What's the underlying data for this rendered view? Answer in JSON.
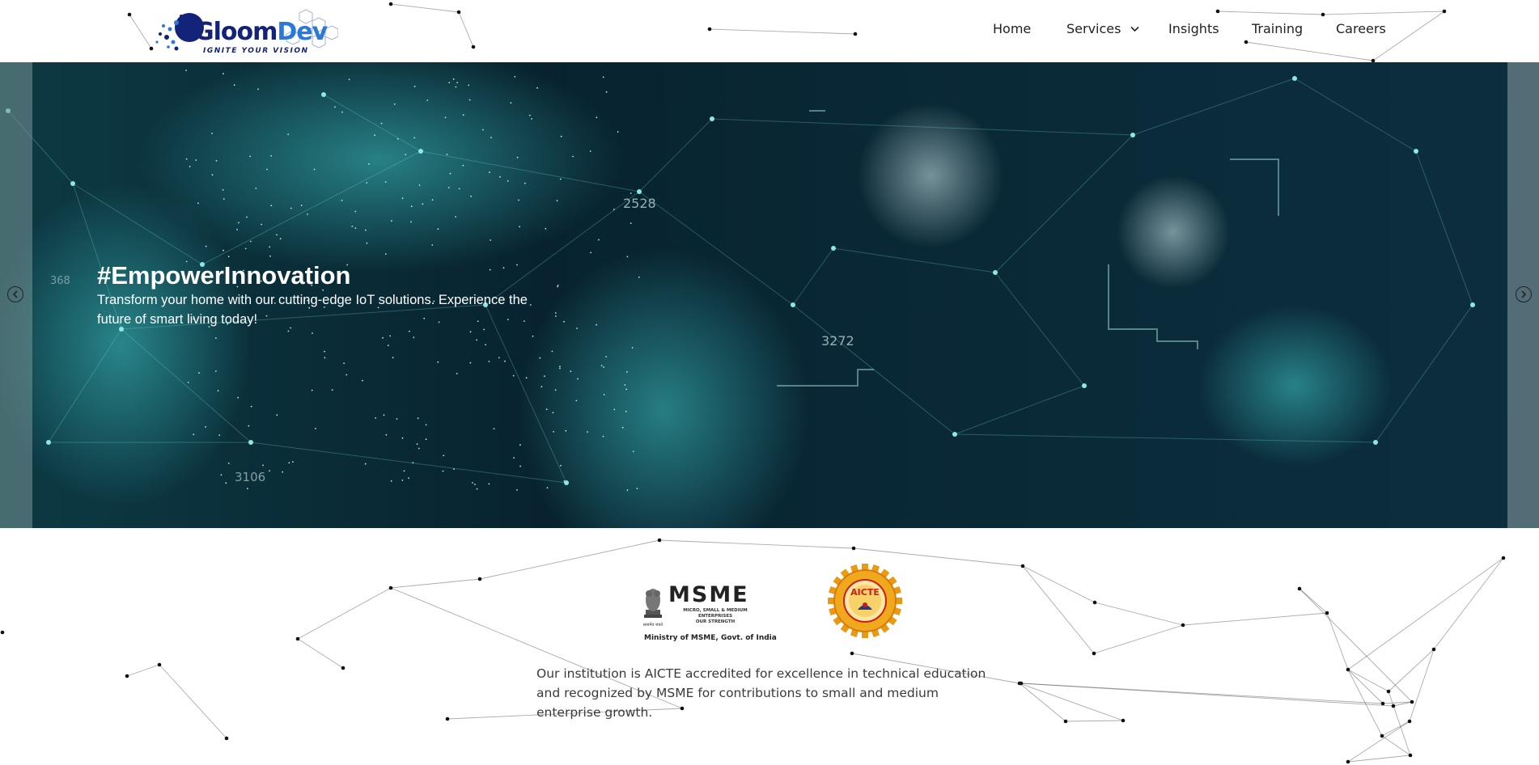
{
  "header": {
    "logo": {
      "name_primary": "Gloom",
      "name_accent": "Dev",
      "tagline": "IGNITE YOUR VISION"
    },
    "nav": [
      {
        "label": "Home"
      },
      {
        "label": "Services",
        "has_dropdown": true
      },
      {
        "label": "Insights"
      },
      {
        "label": "Training"
      },
      {
        "label": "Careers"
      }
    ]
  },
  "hero": {
    "title": "#EmpowerInnovation",
    "subtitle": "Transform your home with our cutting-edge IoT solutions. Experience the future of smart living today!",
    "background_numbers": [
      "2528",
      "3272",
      "3106",
      "368"
    ],
    "prev_icon": "chevron-left-circle-icon",
    "next_icon": "chevron-right-circle-icon"
  },
  "accreditation": {
    "msme": {
      "wordmark": "MSME",
      "small_text": "MICRO, SMALL & MEDIUM ENTERPRISES",
      "motto": "OUR STRENGTH",
      "caption": "Ministry of MSME, Govt. of India"
    },
    "aicte": {
      "label": "AICTE"
    },
    "description": "Our institution is AICTE accredited for excellence in technical education and recognized by MSME for contributions to small and medium enterprise growth."
  },
  "colors": {
    "brand_dark": "#13237a",
    "brand_light": "#2b78d9",
    "hero_bg": "#062030",
    "teal": "#3fc7c7",
    "aicte_gold": "#f0a81c"
  }
}
